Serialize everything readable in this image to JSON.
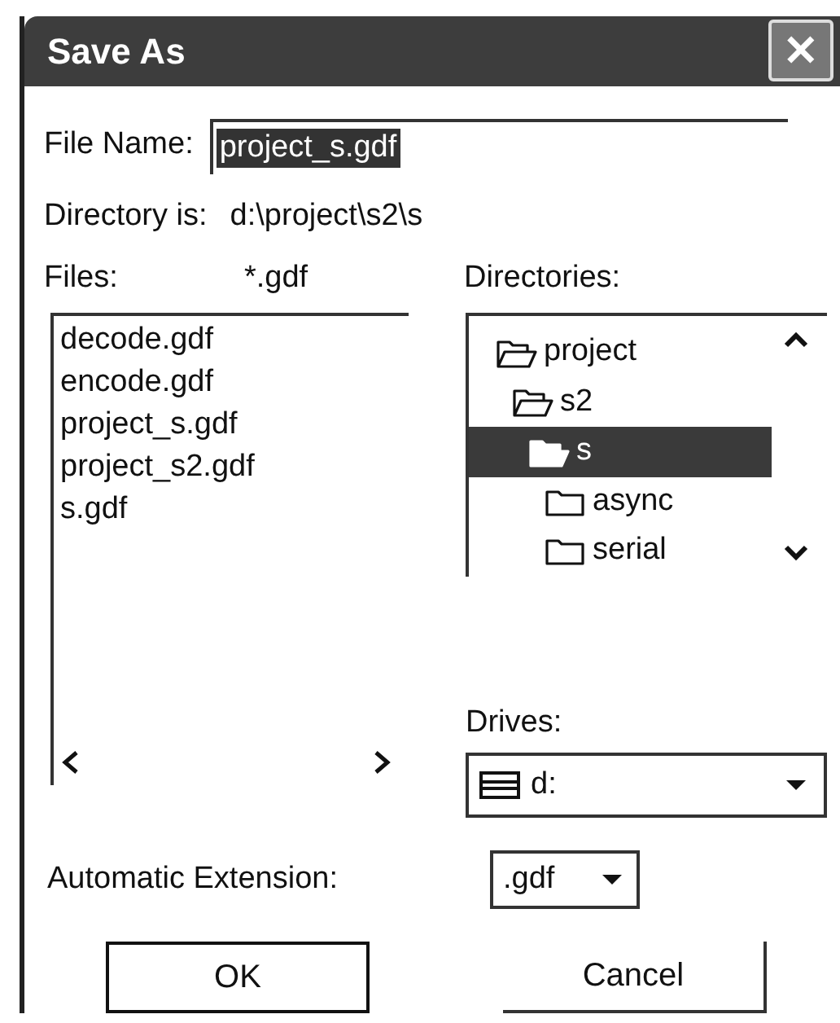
{
  "window": {
    "title": "Save As",
    "close": "✕"
  },
  "file_name": {
    "label": "File Name:",
    "value": "project_s.gdf"
  },
  "directory": {
    "label": "Directory is:",
    "value": "d:\\project\\s2\\s"
  },
  "files": {
    "label": "Files:",
    "filter": "*.gdf",
    "items": [
      {
        "name": "decode.gdf"
      },
      {
        "name": "encode.gdf"
      },
      {
        "name": "project_s.gdf"
      },
      {
        "name": "project_s2.gdf"
      },
      {
        "name": "s.gdf"
      }
    ]
  },
  "directories": {
    "label": "Directories:",
    "tree": [
      {
        "name": "project",
        "expanded": true,
        "selected": false,
        "children": [
          {
            "name": "s2",
            "expanded": true,
            "selected": false,
            "children": [
              {
                "name": "s",
                "expanded": true,
                "selected": true,
                "children": [
                  {
                    "name": "async",
                    "expanded": false,
                    "selected": false
                  },
                  {
                    "name": "serial",
                    "expanded": false,
                    "selected": false
                  }
                ]
              }
            ]
          }
        ]
      }
    ]
  },
  "drives": {
    "label": "Drives:",
    "value": "d:"
  },
  "extension": {
    "label": "Automatic Extension:",
    "value": ".gdf"
  },
  "buttons": [
    {
      "label": "OK",
      "kind": "default"
    },
    {
      "label": "Cancel",
      "kind": "normal"
    }
  ]
}
